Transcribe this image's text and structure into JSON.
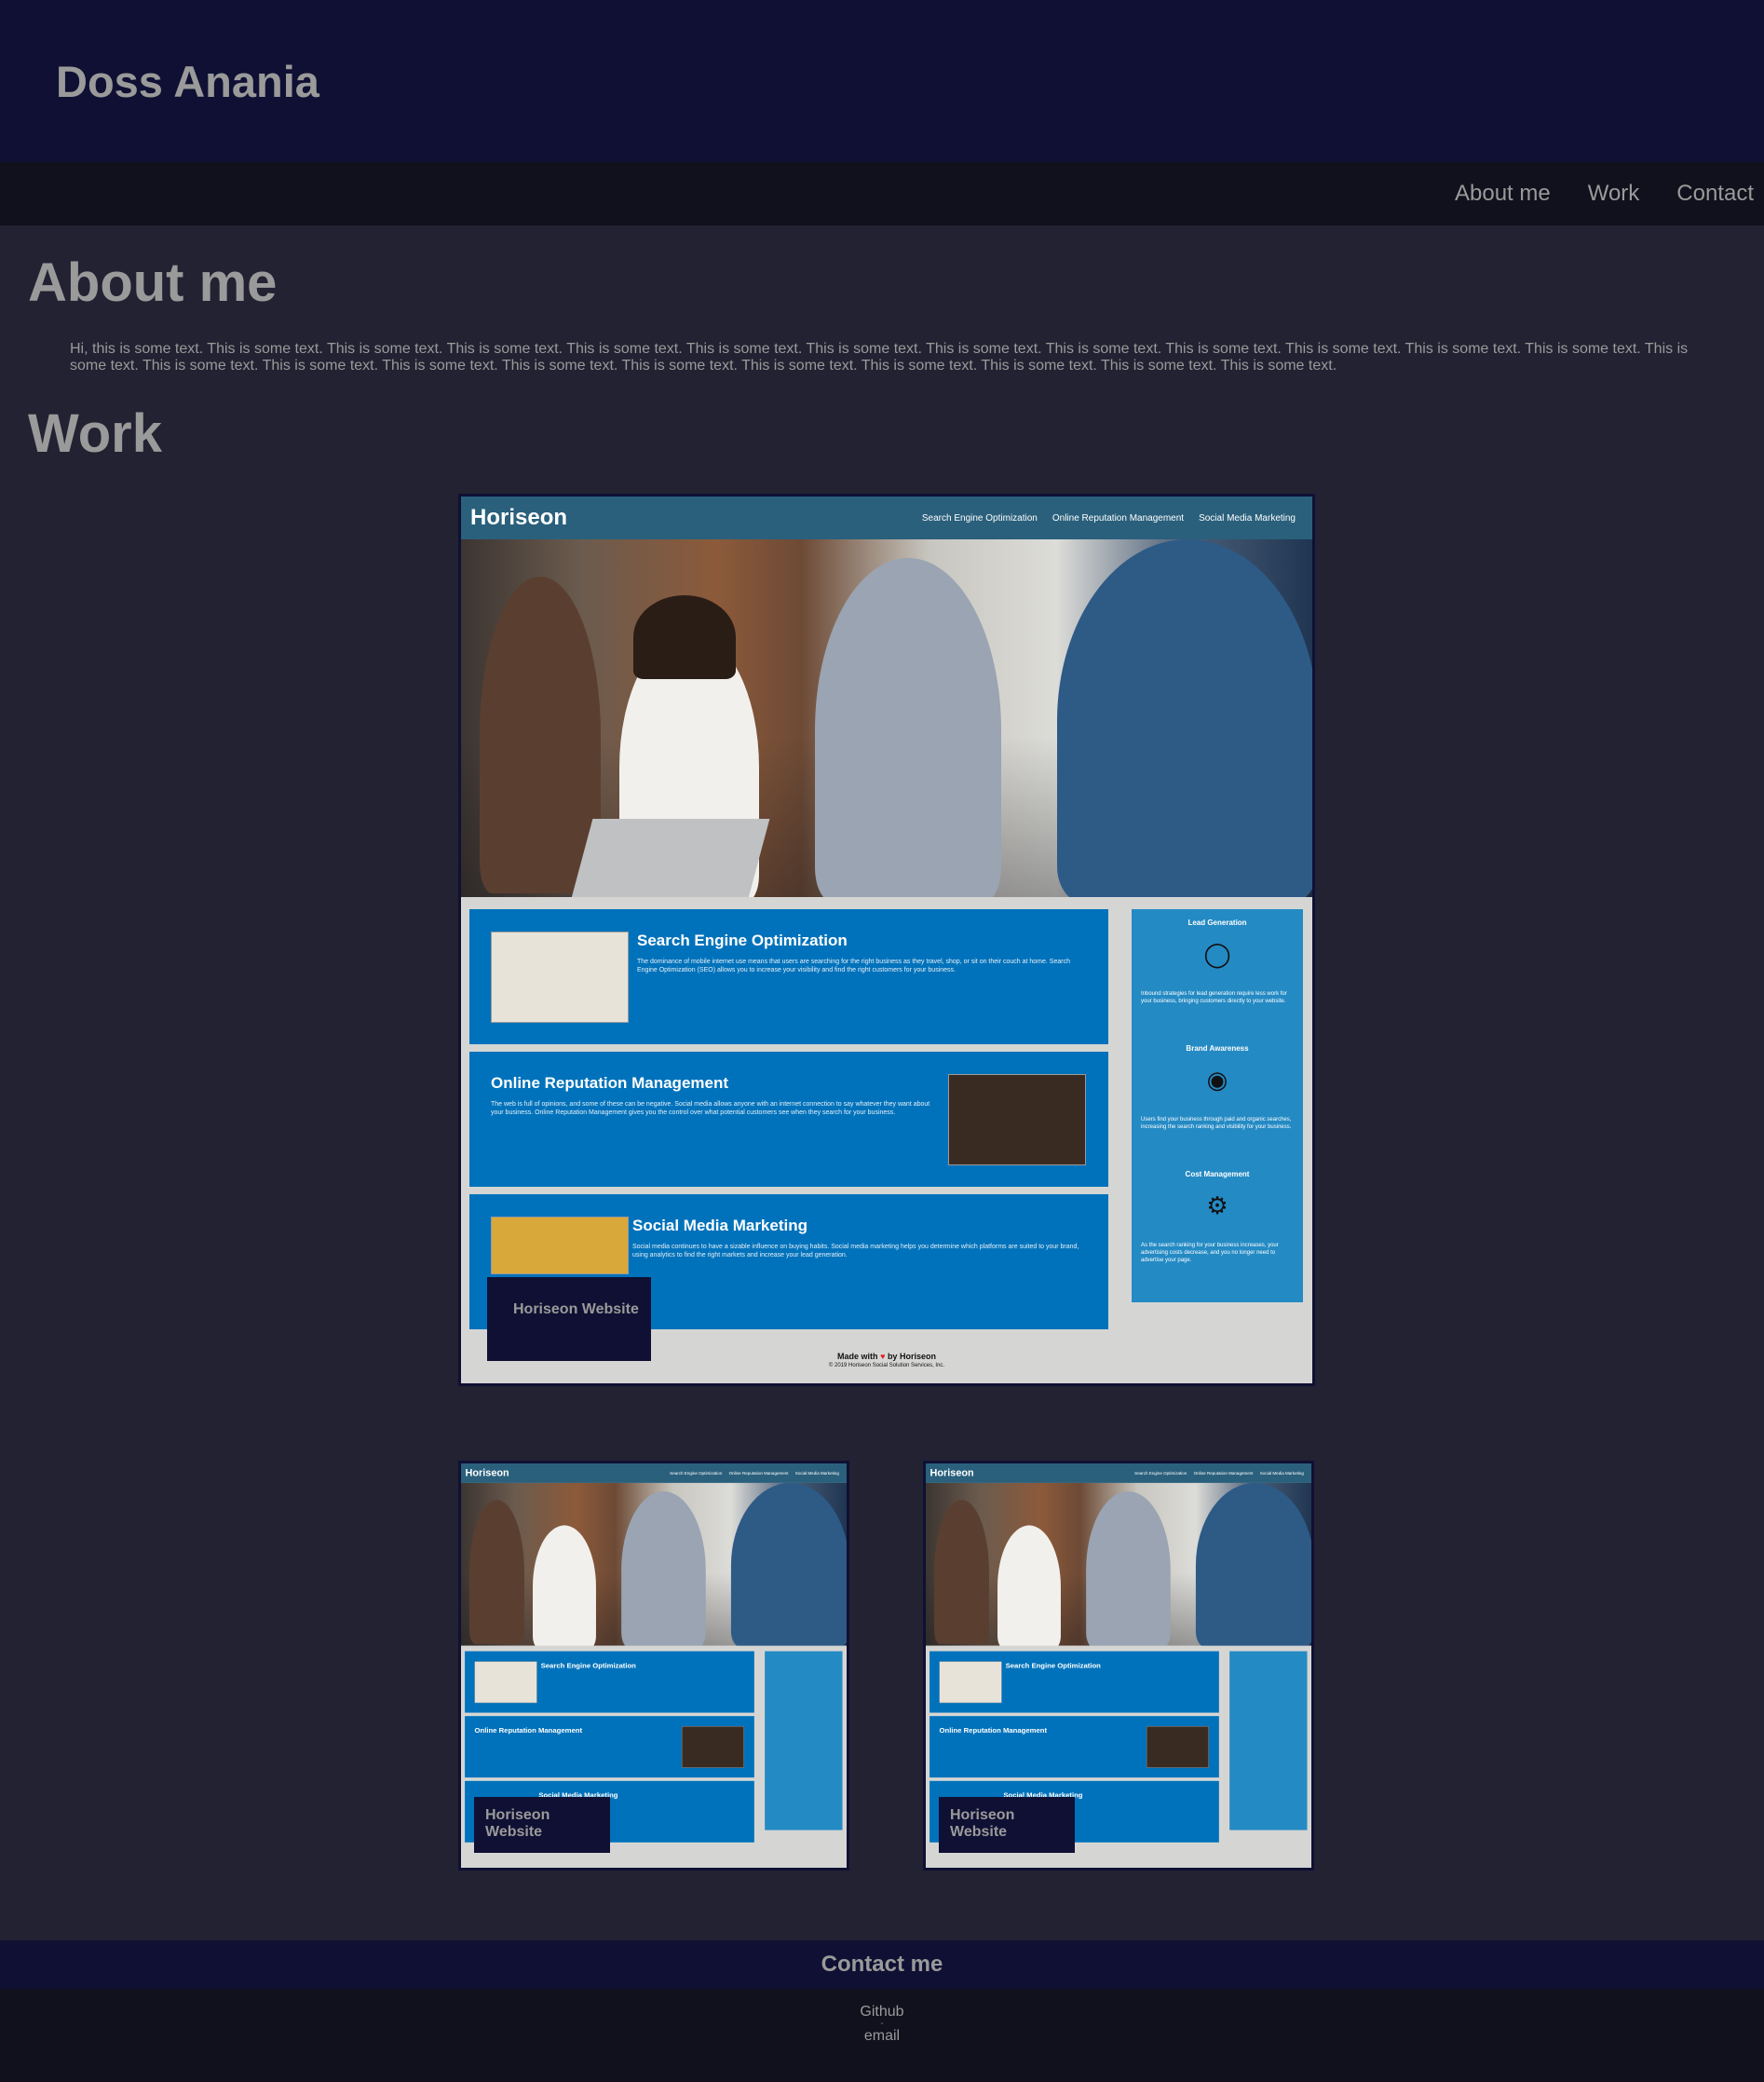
{
  "header": {
    "title": "Doss Anania"
  },
  "nav": {
    "items": [
      "About me",
      "Work",
      "Contact"
    ]
  },
  "about": {
    "heading": "About me",
    "text": "Hi, this is some text. This is some text. This is some text. This is some text. This is some text. This is some text. This is some text. This is some text. This is some text. This is some text. This is some text. This is some text. This is some text. This is some text. This is some text. This is some text. This is some text. This is some text. This is some text. This is some text. This is some text. This is some text. This is some text. This is some text."
  },
  "work": {
    "heading": "Work",
    "project_label": "Horiseon Website",
    "mock": {
      "brand": "Horiseon",
      "nav": [
        "Search Engine Optimization",
        "Online Reputation Management",
        "Social Media Marketing"
      ],
      "cards": [
        {
          "title": "Search Engine Optimization",
          "text": "The dominance of mobile internet use means that users are searching for the right business as they travel, shop, or sit on their couch at home. Search Engine Optimization (SEO) allows you to increase your visibility and find the right customers for your business."
        },
        {
          "title": "Online Reputation Management",
          "text": "The web is full of opinions, and some of these can be negative. Social media allows anyone with an internet connection to say whatever they want about your business. Online Reputation Management gives you the control over what potential customers see when they search for your business."
        },
        {
          "title": "Social Media Marketing",
          "text": "Social media continues to have a sizable influence on buying habits. Social media marketing helps you determine which platforms are suited to your brand, using analytics to find the right markets and increase your lead generation."
        }
      ],
      "aside": [
        {
          "title": "Lead Generation",
          "icon": "lightbulb-icon",
          "text": "Inbound strategies for lead generation require less work for your business, bringing customers directly to your website."
        },
        {
          "title": "Brand Awareness",
          "icon": "broadcast-icon",
          "text": "Users find your business through paid and organic searches, increasing the search ranking and visibility for your business."
        },
        {
          "title": "Cost Management",
          "icon": "gears-dollar-icon",
          "text": "As the search ranking for your business increases, your advertising costs decrease, and you no longer need to advertise your page."
        }
      ],
      "footer": {
        "made_with": "Made with",
        "by": "by Horiseon",
        "copyright": "© 2019 Horiseon Social Solution Services, Inc."
      }
    }
  },
  "contact": {
    "heading": "Contact me",
    "github": "Github",
    "separator": "-",
    "email": "email"
  },
  "colors": {
    "header_bg": "#0f1033",
    "nav_bg": "#11111d",
    "page_bg": "#222233",
    "text": "#9a9a9a",
    "mock_blue": "#0072bb",
    "mock_aside": "#248ac4",
    "mock_header": "#2a607c"
  }
}
